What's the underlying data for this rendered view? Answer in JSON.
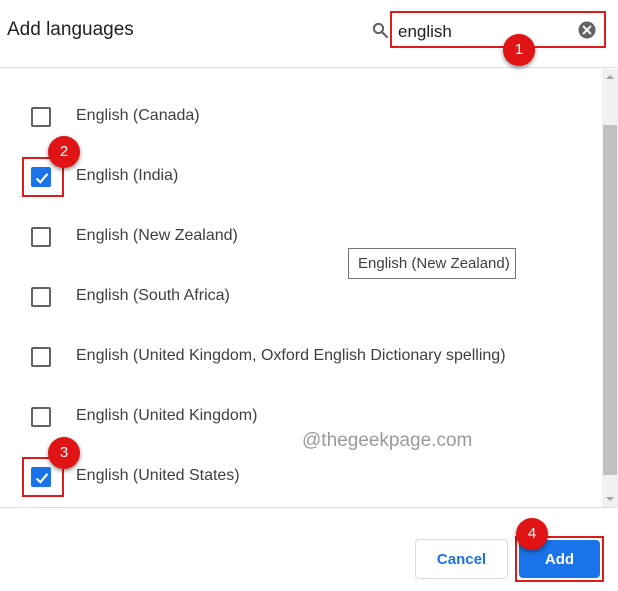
{
  "dialog": {
    "title": "Add languages",
    "search": {
      "value": "english",
      "placeholder": ""
    }
  },
  "languages": [
    {
      "label": "English (Canada)",
      "checked": false
    },
    {
      "label": "English (India)",
      "checked": true
    },
    {
      "label": "English (New Zealand)",
      "checked": false
    },
    {
      "label": "English (South Africa)",
      "checked": false
    },
    {
      "label": "English (United Kingdom, Oxford English Dictionary spelling)",
      "checked": false
    },
    {
      "label": "English (United Kingdom)",
      "checked": false
    },
    {
      "label": "English (United States)",
      "checked": true
    }
  ],
  "tooltip": "English (New Zealand)",
  "watermark": "@thegeekpage.com",
  "buttons": {
    "cancel": "Cancel",
    "add": "Add"
  },
  "annotations": {
    "step1": "1",
    "step2": "2",
    "step3": "3",
    "step4": "4"
  },
  "colors": {
    "accent": "#1a73e8",
    "highlight": "#e01b1b",
    "badge": "#e01414"
  },
  "icons": {
    "search": "search-icon",
    "clear": "clear-icon",
    "check": "check-icon"
  }
}
